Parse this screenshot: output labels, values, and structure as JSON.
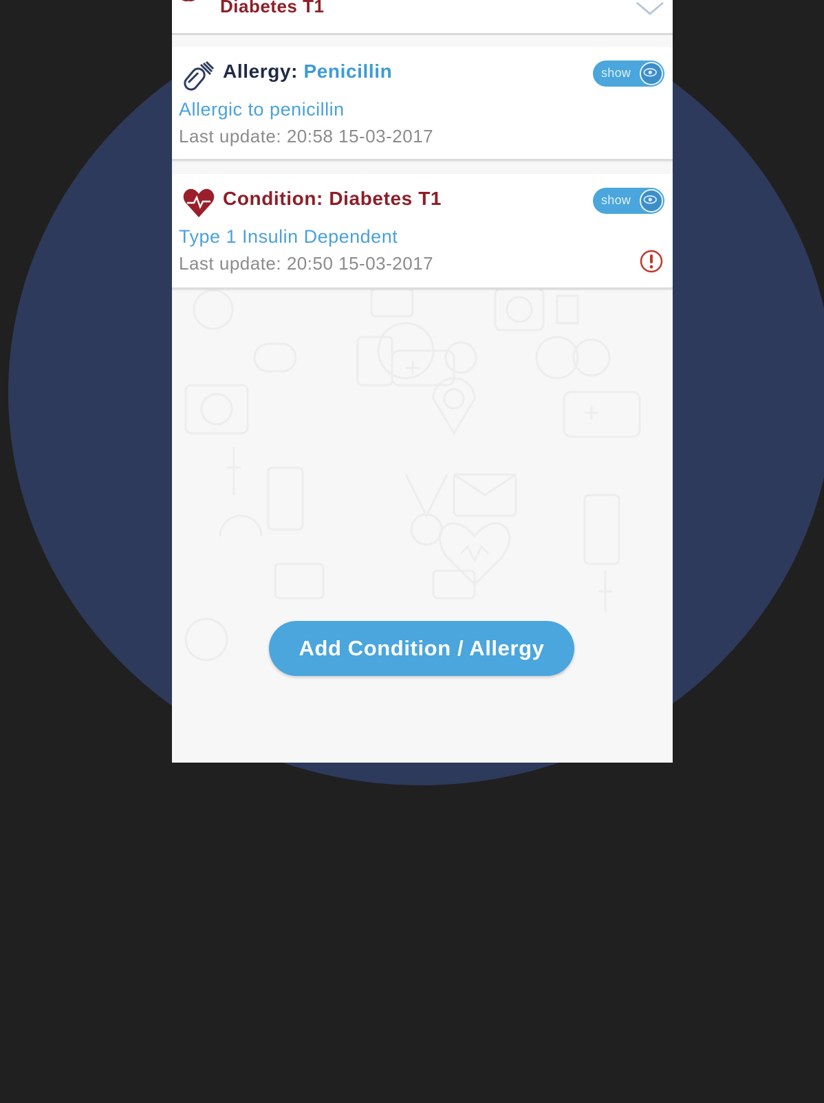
{
  "header": {
    "summary_label": "Diabetes T1"
  },
  "cards": [
    {
      "title_key": "Allergy: ",
      "title_value": "Penicillin",
      "description": "Allergic to penicillin",
      "last_update": "Last update: 20:58 15-03-2017",
      "toggle_label": "show",
      "icon": "pill-icon"
    },
    {
      "title_key": "Condition: ",
      "title_value": "Diabetes T1",
      "description": "Type 1 Insulin Dependent",
      "last_update": "Last update: 20:50 15-03-2017",
      "toggle_label": "show",
      "icon": "heart-pulse-icon",
      "warning_icon": "alert-icon"
    }
  ],
  "actions": {
    "add_label": "Add Condition / Allergy"
  },
  "colors": {
    "accent_blue": "#4aa6dc",
    "condition_red": "#8e1e28",
    "navy": "#1f2a44",
    "backdrop_circle": "#2d3a5c",
    "page_bg": "#202020"
  }
}
